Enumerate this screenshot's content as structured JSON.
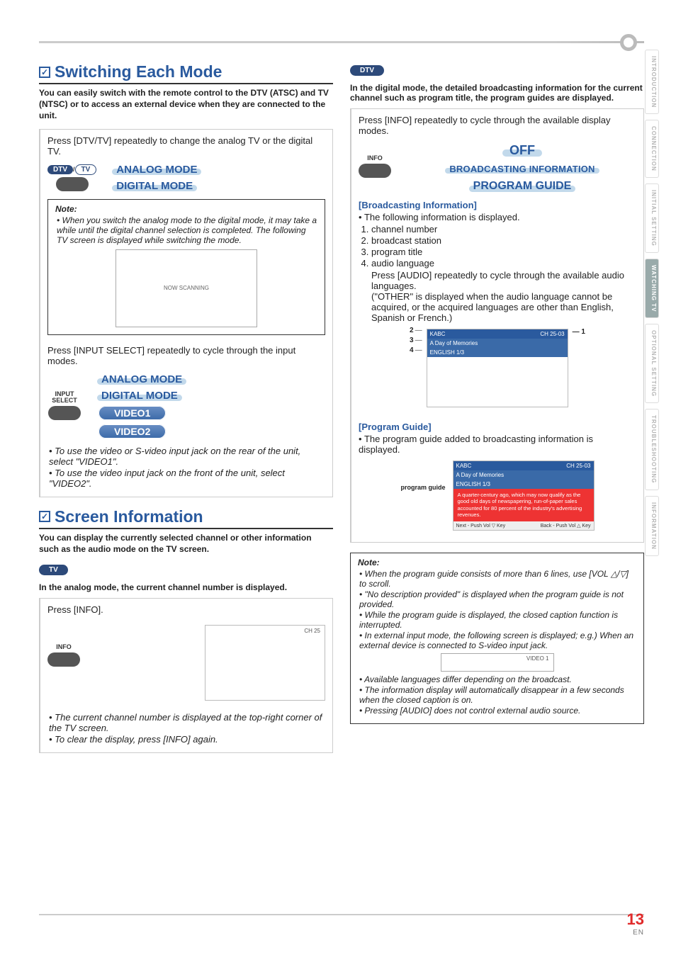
{
  "sidetabs": [
    "INTRODUCTION",
    "CONNECTION",
    "INITIAL SETTING",
    "WATCHING TV",
    "OPTIONAL SETTING",
    "TROUBLESHOOTING",
    "INFORMATION"
  ],
  "active_tab_index": 3,
  "left": {
    "sec1_title": "Switching Each Mode",
    "sec1_lead": "You can easily switch with the remote control to the DTV (ATSC) and TV (NTSC) or to access an external device when they are connected to the unit.",
    "panel1_text": "Press [DTV/TV] repeatedly to change the analog TV or the digital TV.",
    "panel1_key_top_dark": "DTV",
    "panel1_key_top_light": "TV",
    "modes_a": [
      "ANALOG MODE",
      "DIGITAL MODE"
    ],
    "note1_title": "Note:",
    "note1_items": [
      "When you switch the analog mode to the digital mode, it may take a while until the digital channel selection is completed. The following TV screen is displayed while switching the mode."
    ],
    "now_scanning": "NOW SCANNING",
    "panel2_text": "Press [INPUT SELECT] repeatedly to cycle through the input modes.",
    "panel2_key_label": "INPUT SELECT",
    "modes_b_plain": [
      "ANALOG MODE",
      "DIGITAL MODE"
    ],
    "modes_b_badge": [
      "VIDEO1",
      "VIDEO2"
    ],
    "panel2_bullets": [
      "To use the video or S-video input jack on the rear of the unit, select \"VIDEO1\".",
      "To use the video input jack on the front of the unit, select \"VIDEO2\"."
    ],
    "sec2_title": "Screen Information",
    "sec2_lead": "You can display the currently selected channel or other information such as the audio mode on the TV screen.",
    "tag_tv": "TV",
    "sec2_sub": "In the analog mode, the current channel number is displayed.",
    "panel3_text": "Press [INFO].",
    "panel3_key_label": "INFO",
    "panel3_ch": "CH 25",
    "panel3_bullets": [
      "The current channel number is displayed at the top-right corner of the TV screen.",
      "To clear the display, press [INFO] again."
    ]
  },
  "right": {
    "tag_dtv": "DTV",
    "sub": "In the digital mode, the detailed broadcasting information for the current channel such as program title, the program guides are displayed.",
    "panel1_text": "Press [INFO] repeatedly to cycle through the available display modes.",
    "panel1_key_label": "INFO",
    "off": "OFF",
    "broadcasting": "BROADCASTING INFORMATION",
    "program_guide": "PROGRAM GUIDE",
    "bi_heading": "[Broadcasting Information]",
    "bi_lead": "The following information is displayed.",
    "bi_items": [
      "channel number",
      "broadcast station",
      "program title",
      "audio language"
    ],
    "bi_audio_line": "Press [AUDIO] repeatedly to cycle through the available audio languages.",
    "bi_audio_note": "(\"OTHER\" is displayed when the audio language cannot be acquired, or the acquired languages are other than English, Spanish or French.)",
    "osd_station": "KABC",
    "osd_channel": "CH 25-03",
    "osd_title": "A Day of Memories",
    "osd_lang": "ENGLISH  1/3",
    "pg_heading": "[Program Guide]",
    "pg_lead": "The program guide added to broadcasting information is displayed.",
    "pg_label": "program guide",
    "pg_text": "A quarter-century ago, which may now qualify as the good old days of newspapering, run-of-paper sales accounted for 80 percent of the industry's advertising revenues.",
    "pg_foot_left": "Next - Push Vol ▽ Key",
    "pg_foot_right": "Back - Push Vol △ Key",
    "note_title": "Note:",
    "note_items": [
      "When the program guide consists of more than 6 lines, use [VOL △/▽] to scroll.",
      "\"No description provided\" is displayed when the program guide is not provided.",
      "While the program guide is displayed, the closed caption function is interrupted.",
      "In external input mode, the following screen is displayed; e.g.) When an external device is connected to S-video input jack."
    ],
    "note_video1": "VIDEO 1",
    "note_items2": [
      "Available languages differ depending on the broadcast.",
      "The information display will automatically disappear in a few seconds when the closed caption is on.",
      "Pressing [AUDIO] does not control external audio source."
    ]
  },
  "footer": {
    "page": "13",
    "en": "EN"
  }
}
